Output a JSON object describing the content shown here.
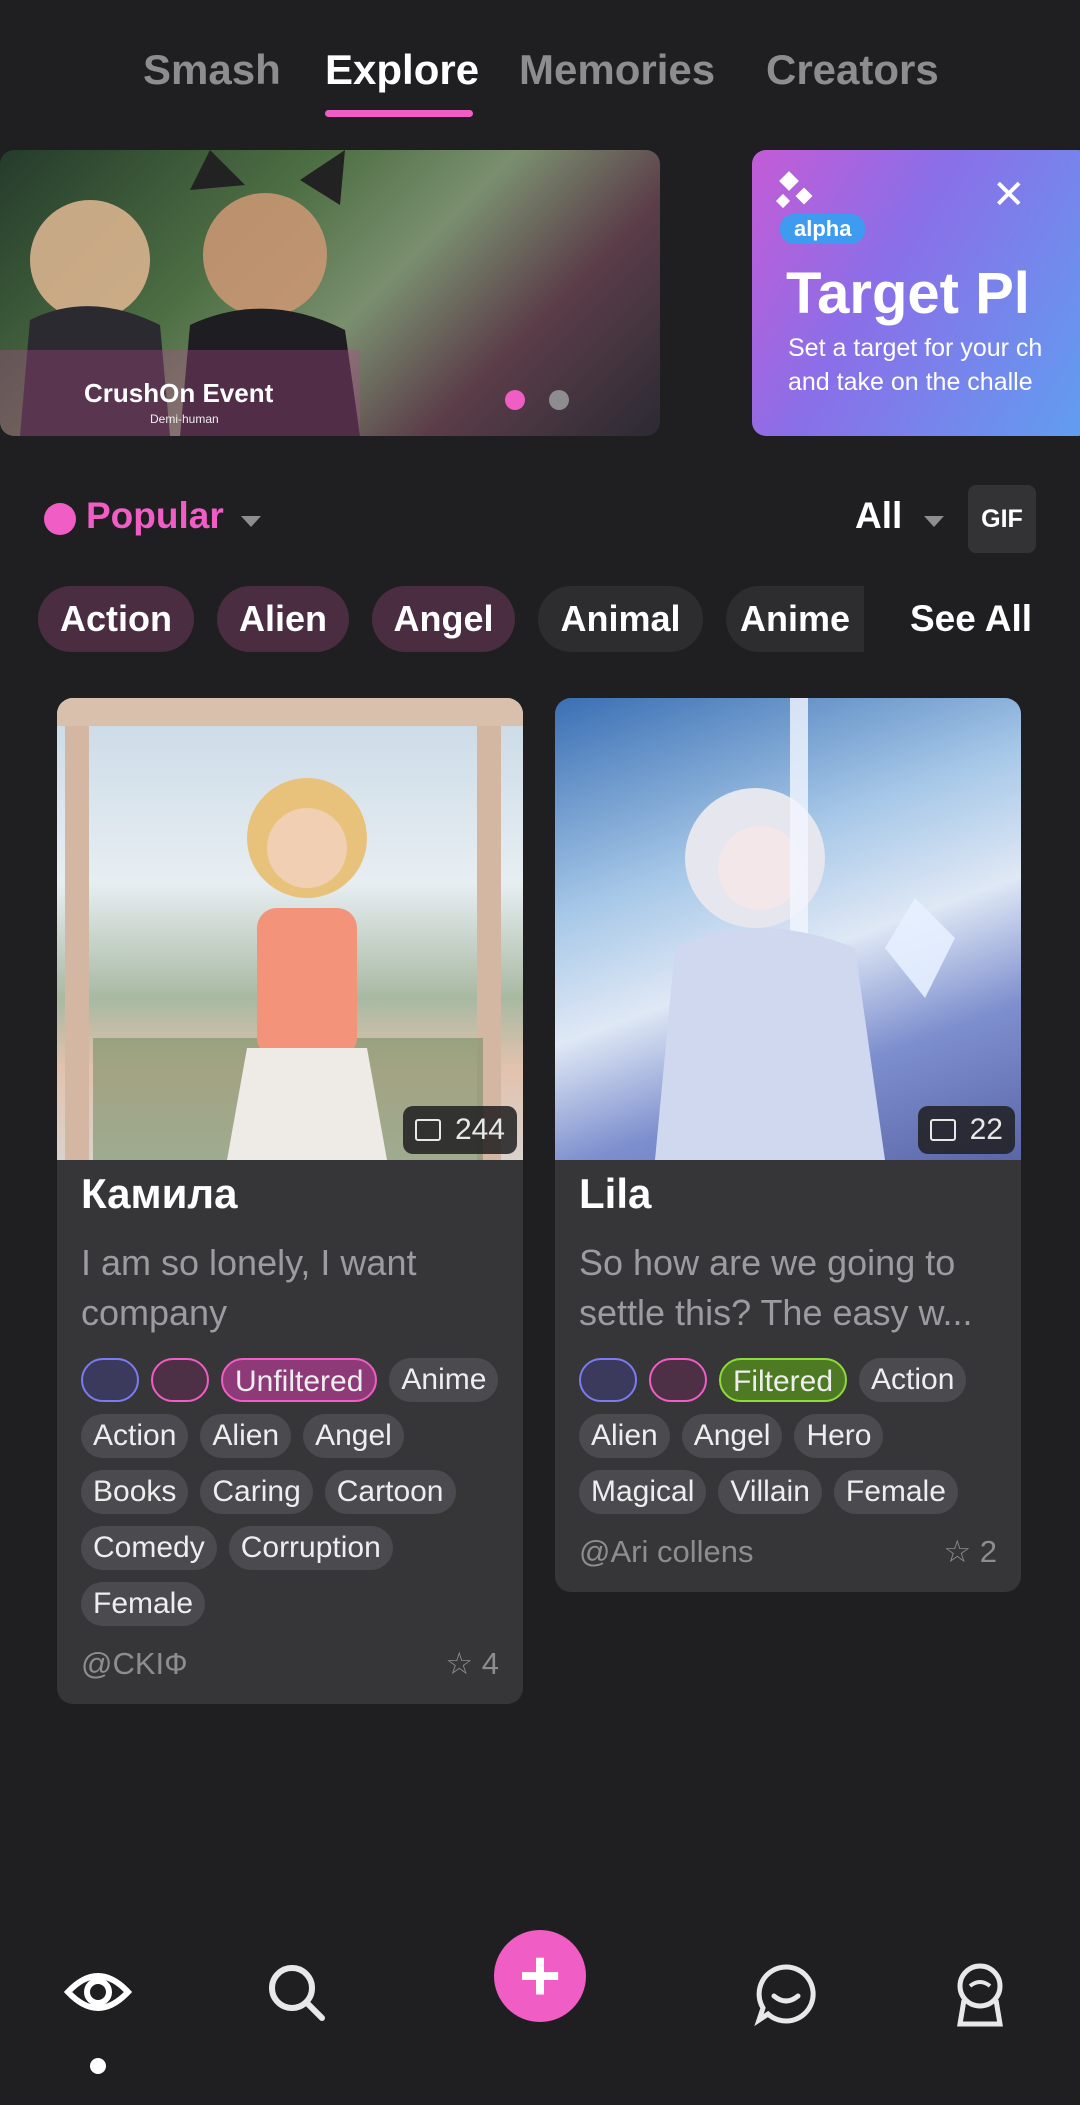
{
  "top_tabs": [
    {
      "label": "Smash",
      "active": false
    },
    {
      "label": "Explore",
      "active": true
    },
    {
      "label": "Memories",
      "active": false
    },
    {
      "label": "Creators",
      "active": false
    }
  ],
  "banners": {
    "event": {
      "title": "CrushOn Event",
      "subtitle": "Demi-human"
    },
    "promo": {
      "badge": "alpha",
      "title": "Target Pl",
      "line1": "Set a target for your ch",
      "line2": "and take on the challe",
      "close_icon": "close-icon"
    },
    "dots": {
      "count": 2,
      "active_index": 0
    }
  },
  "filters": {
    "sort_label": "Popular",
    "scope_label": "All",
    "gif_label": "GIF"
  },
  "chips": [
    {
      "label": "Action",
      "selected": true
    },
    {
      "label": "Alien",
      "selected": true
    },
    {
      "label": "Angel",
      "selected": true
    },
    {
      "label": "Animal",
      "selected": false
    },
    {
      "label": "Anime",
      "selected": false
    }
  ],
  "see_all_label": "See All",
  "cards": [
    {
      "name": "Камила",
      "messages": "244",
      "description": "I am so lonely, I want company",
      "rating_label": "Unfiltered",
      "tags": [
        "Anime",
        "Action",
        "Alien",
        "Angel",
        "Books",
        "Caring",
        "Cartoon",
        "Comedy",
        "Corruption",
        "Female"
      ],
      "creator": "@CKIФ",
      "stars": "4"
    },
    {
      "name": "Lila",
      "messages": "22",
      "description": "So how are we going to settle this? The easy w...",
      "rating_label": "Filtered",
      "tags": [
        "Action",
        "Alien",
        "Angel",
        "Hero",
        "Magical",
        "Villain",
        "Female"
      ],
      "creator": "@Ari collens",
      "stars": "2"
    }
  ],
  "colors": {
    "accent": "#f05dc4",
    "background": "#1f1f21",
    "card": "#363538",
    "filtered_green": "#8fdb3d",
    "icon_purple": "#7b7bf0"
  },
  "bottom_nav_icons": [
    "eye-icon",
    "search-icon",
    "plus-icon",
    "chat-icon",
    "profile-icon"
  ]
}
